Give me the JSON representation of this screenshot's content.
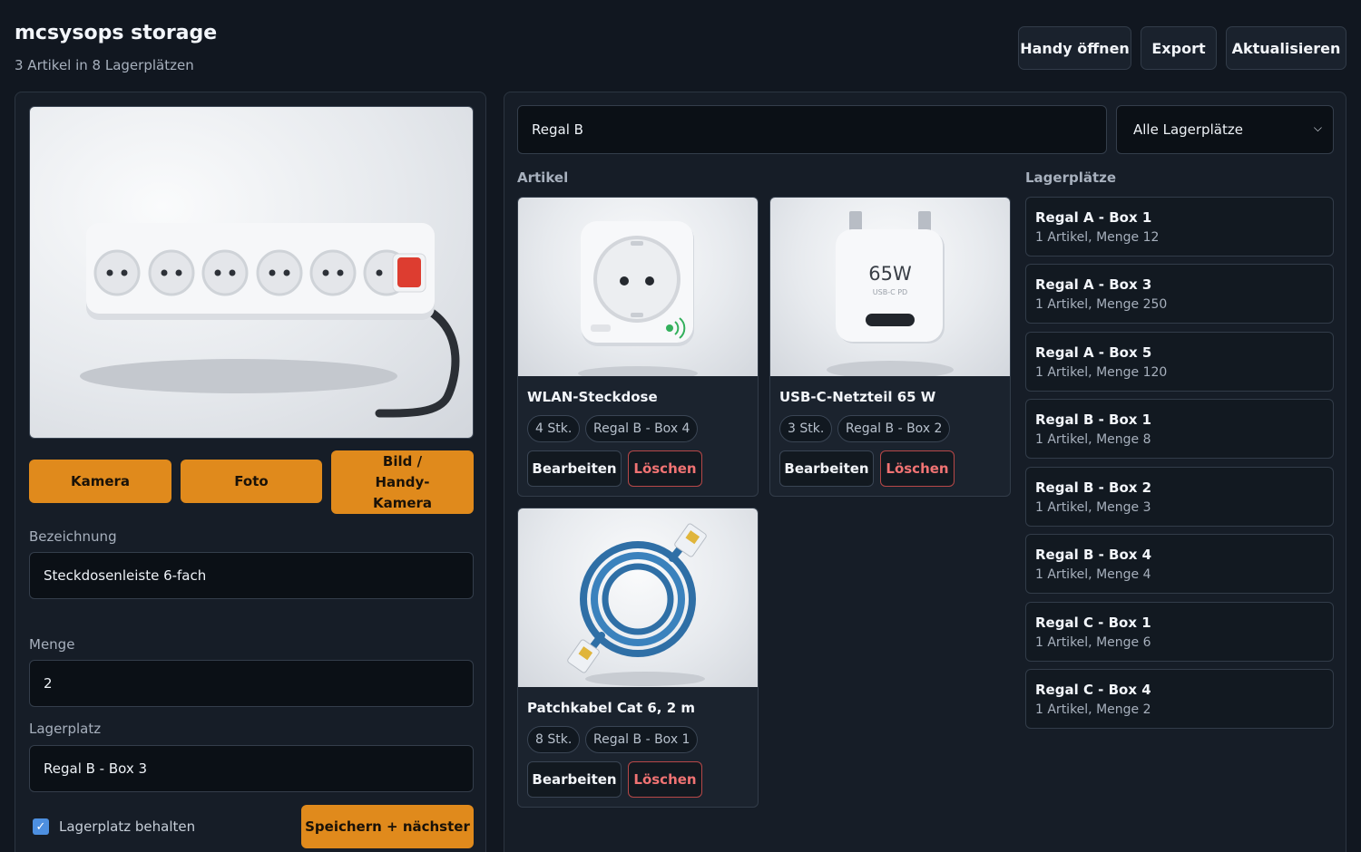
{
  "header": {
    "title": "mcsysops storage",
    "subtitle": "3 Artikel in 8 Lagerplätzen",
    "buttons": {
      "phone": "Handy öffnen",
      "export": "Export",
      "refresh": "Aktualisieren"
    }
  },
  "form": {
    "buttons": {
      "camera": "Kamera",
      "photo": "Foto",
      "image_phone": "Bild / Handy-Kamera",
      "save_next": "Speichern + nächster"
    },
    "name_label": "Bezeichnung",
    "name_value": "Steckdosenleiste 6-fach",
    "quantity_label": "Menge",
    "quantity_value": "2",
    "location_label": "Lagerplatz",
    "location_value": "Regal B - Box 3",
    "keep_location_label": "Lagerplatz behalten",
    "keep_location_checked": true
  },
  "browser": {
    "search_value": "Regal B",
    "filter_selected": "Alle Lagerplätze",
    "items_heading": "Artikel",
    "locations_heading": "Lagerplätze",
    "items": [
      {
        "name": "WLAN-Steckdose",
        "qty": "4 Stk.",
        "location": "Regal B - Box 4",
        "edit": "Bearbeiten",
        "delete": "Löschen",
        "icon": "smart-plug"
      },
      {
        "name": "USB-C-Netzteil 65 W",
        "qty": "3 Stk.",
        "location": "Regal B - Box 2",
        "edit": "Bearbeiten",
        "delete": "Löschen",
        "icon": "usb-c-charger"
      },
      {
        "name": "Patchkabel Cat 6, 2 m",
        "qty": "8 Stk.",
        "location": "Regal B - Box 1",
        "edit": "Bearbeiten",
        "delete": "Löschen",
        "icon": "patch-cable"
      }
    ],
    "charger_text": {
      "watt": "65W",
      "sub": "USB-C PD"
    },
    "locations": [
      {
        "name": "Regal A - Box 1",
        "info": "1 Artikel, Menge 12"
      },
      {
        "name": "Regal A - Box 3",
        "info": "1 Artikel, Menge 250"
      },
      {
        "name": "Regal A - Box 5",
        "info": "1 Artikel, Menge 120"
      },
      {
        "name": "Regal B - Box 1",
        "info": "1 Artikel, Menge 8"
      },
      {
        "name": "Regal B - Box 2",
        "info": "1 Artikel, Menge 3"
      },
      {
        "name": "Regal B - Box 4",
        "info": "1 Artikel, Menge 4"
      },
      {
        "name": "Regal C - Box 1",
        "info": "1 Artikel, Menge 6"
      },
      {
        "name": "Regal C - Box 4",
        "info": "1 Artikel, Menge 2"
      }
    ]
  },
  "colors": {
    "accent": "#e08a1c",
    "danger": "#f07373",
    "background": "#111720",
    "panel": "#161d27"
  }
}
